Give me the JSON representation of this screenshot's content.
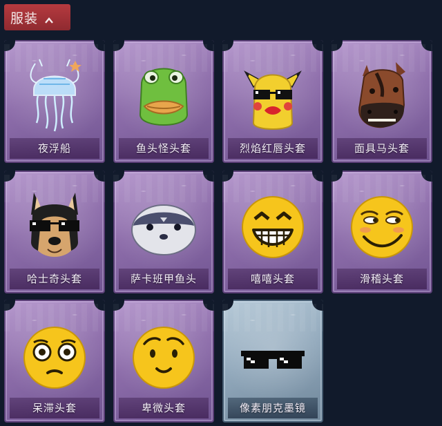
{
  "header": {
    "title": "服装",
    "collapse_icon": "chevron-up-icon",
    "color": "#a8333a"
  },
  "items": [
    {
      "label": "夜浮船",
      "icon": "jellyfish-icon",
      "rarity": "purple"
    },
    {
      "label": "鱼头怪头套",
      "icon": "fish-head-mask-icon",
      "rarity": "purple"
    },
    {
      "label": "烈焰红唇头套",
      "icon": "pikachu-lips-mask-icon",
      "rarity": "purple"
    },
    {
      "label": "面具马头套",
      "icon": "horse-head-mask-icon",
      "rarity": "purple"
    },
    {
      "label": "哈士奇头套",
      "icon": "husky-sunglasses-mask-icon",
      "rarity": "purple"
    },
    {
      "label": "萨卡班甲鱼头",
      "icon": "sacabambaspis-head-icon",
      "rarity": "purple"
    },
    {
      "label": "嘻嘻头套",
      "icon": "grin-emoji-mask-icon",
      "rarity": "purple"
    },
    {
      "label": "滑稽头套",
      "icon": "smirk-emoji-mask-icon",
      "rarity": "purple"
    },
    {
      "label": "呆滞头套",
      "icon": "dazed-emoji-mask-icon",
      "rarity": "purple"
    },
    {
      "label": "卑微头套",
      "icon": "humble-emoji-mask-icon",
      "rarity": "purple"
    },
    {
      "label": "像素朋克墨镜",
      "icon": "pixel-sunglasses-icon",
      "rarity": "blue"
    }
  ]
}
